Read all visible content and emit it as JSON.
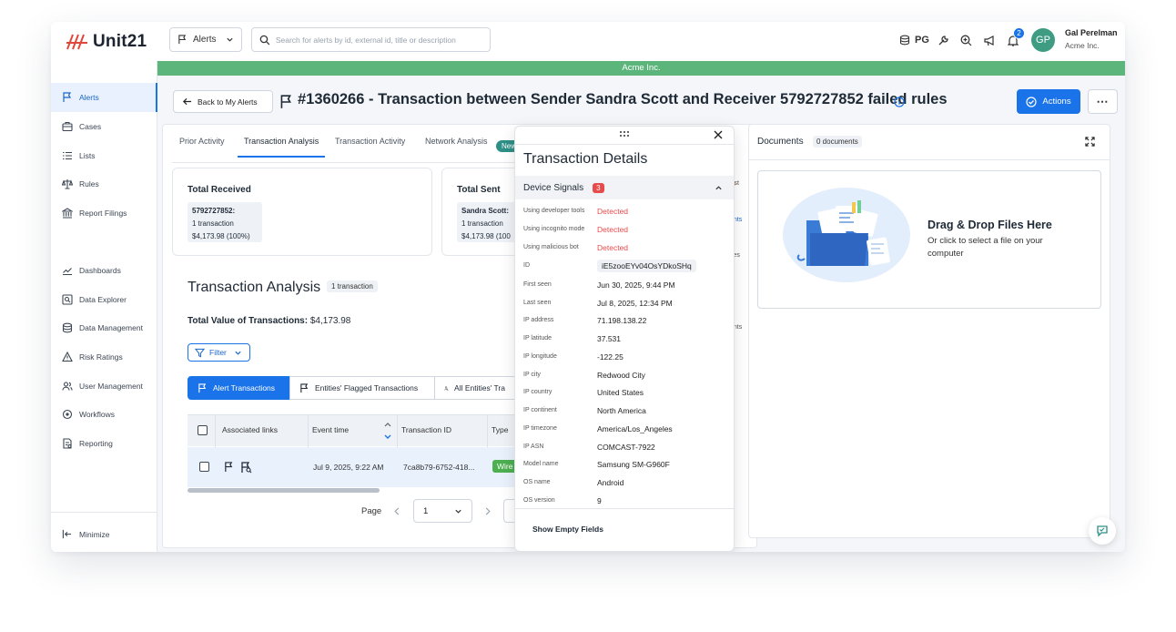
{
  "app": {
    "logo_text": "Unit21",
    "accent": "#1a73e8",
    "org_bar_color": "#5cb57a"
  },
  "topbar": {
    "module_select": "Alerts",
    "search_placeholder": "Search for alerts by id, external id, title or description",
    "icons": [
      "database-icon",
      "pg-text",
      "tools-icon",
      "zoom-icon",
      "megaphone-icon",
      "bell-icon"
    ],
    "pg_label": "PG",
    "notification_count": "2",
    "user_initials": "GP",
    "user_name": "Gal Perelman",
    "user_org": "Acme Inc."
  },
  "org_bar": "Acme Inc.",
  "sidebar": {
    "items": [
      {
        "label": "Alerts",
        "icon": "flag-icon",
        "active": true
      },
      {
        "label": "Cases",
        "icon": "briefcase-icon"
      },
      {
        "label": "Lists",
        "icon": "list-icon"
      },
      {
        "label": "Rules",
        "icon": "scale-icon"
      },
      {
        "label": "Report Filings",
        "icon": "bank-icon"
      },
      {
        "label": "Dashboards",
        "icon": "chart-icon"
      },
      {
        "label": "Data Explorer",
        "icon": "search-data-icon"
      },
      {
        "label": "Data Management",
        "icon": "database-icon"
      },
      {
        "label": "Risk Ratings",
        "icon": "warning-icon"
      },
      {
        "label": "User Management",
        "icon": "users-icon"
      },
      {
        "label": "Workflows",
        "icon": "workflow-icon"
      },
      {
        "label": "Reporting",
        "icon": "report-icon"
      }
    ],
    "minimize": "Minimize"
  },
  "header": {
    "back_label": "Back to My Alerts",
    "title": "#1360266 - Transaction between Sender Sandra Scott and Receiver 5792727852 failed rules",
    "actions_label": "Actions",
    "more_label": "⋯"
  },
  "tabs": [
    {
      "label": "Prior Activity"
    },
    {
      "label": "Transaction Analysis",
      "active": true
    },
    {
      "label": "Transaction Activity"
    },
    {
      "label": "Network Analysis"
    }
  ],
  "new_badge": "New",
  "cards": [
    {
      "title": "Total Received",
      "line1": "5792727852:",
      "line2": "1 transaction",
      "line3": "$4,173.98 (100%)"
    },
    {
      "title": "Total Sent",
      "line1": "Sandra Scott:",
      "line2": "1 transaction",
      "line3": "$4,173.98 (100"
    }
  ],
  "analysis": {
    "title": "Transaction Analysis",
    "count": "1 transaction",
    "total_label": "Total Value of Transactions:",
    "total_value": "$4,173.98",
    "filter": "Filter",
    "segments": [
      "Alert Transactions",
      "Entities' Flagged Transactions",
      "All Entities' Tra"
    ],
    "columns": [
      "Associated links",
      "Event time",
      "Transaction ID",
      "Type"
    ],
    "rows": [
      {
        "event_time": "Jul 9, 2025, 9:22 AM",
        "transaction_id": "7ca8b79-6752-418...",
        "type": "Wire"
      }
    ],
    "page_label": "Page",
    "page_value": "1"
  },
  "details": {
    "title": "Transaction Details",
    "section": "Device Signals",
    "section_count": "3",
    "fields": [
      {
        "k": "Using developer tools",
        "v": "Detected",
        "red": true
      },
      {
        "k": "Using incognito mode",
        "v": "Detected",
        "red": true
      },
      {
        "k": "Using malicious bot",
        "v": "Detected",
        "red": true
      },
      {
        "k": "ID",
        "v": "iE5zooEYv04OsYDkoSHq"
      },
      {
        "k": "First seen",
        "v": "Jun 30, 2025, 9:44 PM"
      },
      {
        "k": "Last seen",
        "v": "Jul 8, 2025, 12:34 PM"
      },
      {
        "k": "IP address",
        "v": "71.198.138.22"
      },
      {
        "k": "IP latitude",
        "v": "37.531"
      },
      {
        "k": "IP longitude",
        "v": "-122.25"
      },
      {
        "k": "IP city",
        "v": "Redwood City"
      },
      {
        "k": "IP country",
        "v": "United States"
      },
      {
        "k": "IP continent",
        "v": "North America"
      },
      {
        "k": "IP timezone",
        "v": "America/Los_Angeles"
      },
      {
        "k": "IP ASN",
        "v": "COMCAST-7922"
      },
      {
        "k": "Model name",
        "v": "Samsung SM-G960F"
      },
      {
        "k": "OS name",
        "v": "Android"
      },
      {
        "k": "OS version",
        "v": "9"
      }
    ],
    "show_empty": "Show Empty Fields",
    "peek_labels": [
      "ist",
      "ents",
      "ves",
      "s",
      "ents",
      "t"
    ]
  },
  "documents": {
    "title": "Documents",
    "count": "0 documents",
    "drop_title": "Drag & Drop Files Here",
    "drop_sub": "Or click to select a file on your computer"
  }
}
